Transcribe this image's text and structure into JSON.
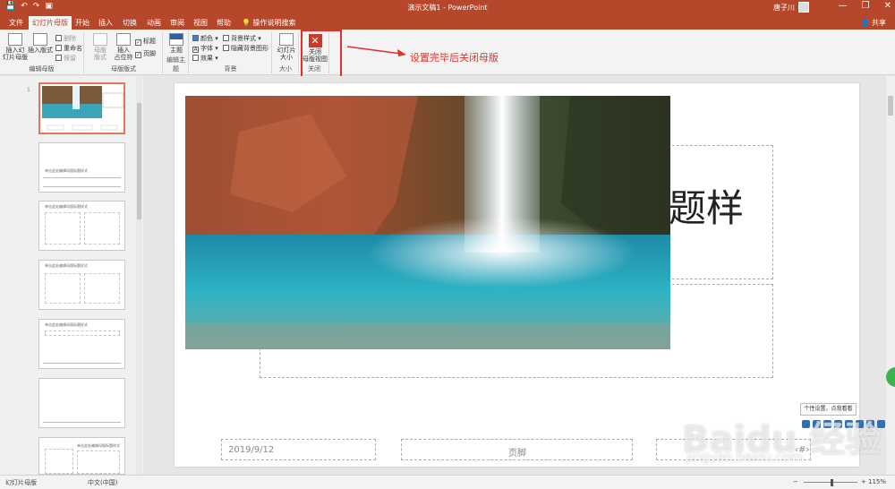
{
  "window": {
    "title": "演示文稿1  -  PowerPoint",
    "user": "唐子川",
    "controls": [
      "—",
      "❐",
      "✕"
    ]
  },
  "qat": [
    "💾",
    "↶",
    "↷",
    "▣"
  ],
  "tabs": [
    "文件",
    "幻灯片母版",
    "开始",
    "插入",
    "切换",
    "动画",
    "审阅",
    "视图",
    "帮助",
    "操作说明搜索"
  ],
  "share_label": "共享",
  "ribbon": {
    "edit_master": {
      "insert_master": "插入幻\n灯片母版",
      "insert_layout": "插入版式",
      "delete": "删除",
      "rename": "重命名",
      "preserve": "保留",
      "label": "编辑母版"
    },
    "master_layout": {
      "master_layout_btn": "母版\n版式",
      "insert_placeholder": "插入\n占位符",
      "title_check": "标题",
      "footer_check": "页脚",
      "label": "母版版式"
    },
    "edit_theme": {
      "theme_btn": "主题",
      "label": "编辑主题"
    },
    "background": {
      "colors": "颜色",
      "fonts": "字体",
      "effects": "效果",
      "bg_styles": "背景样式",
      "hide_bg": "隐藏背景图形",
      "label": "背景"
    },
    "size": {
      "slide_size": "幻灯片\n大小",
      "label": "大小"
    },
    "close": {
      "close_master_view": "关闭\n母版视图",
      "label": "关闭"
    }
  },
  "annotation": "设置完毕后关闭母版",
  "colors": {
    "accent": "#b7472a",
    "annotation": "#e0312a"
  },
  "slide": {
    "title_fragment": "题样",
    "date": "2019/9/12",
    "footer": "页脚",
    "page_number": "‹#›"
  },
  "thumbnails": {
    "t2_title": "单击此处编辑母版标题样式",
    "t3_title": "单击此处编辑母版标题样式",
    "t4_title": "单击此处编辑母版标题样式",
    "t5_title": "单击此处编辑母版标题样式",
    "t7_title": "单击此处编辑母版标题样式"
  },
  "tooltip": "个性设置，点我看看",
  "watermark": {
    "brand": "Baidu 经验",
    "url": "jingyan.baidu.com"
  },
  "status": {
    "view": "幻灯片母版",
    "language": "中文(中国)",
    "zoom": "115%"
  }
}
